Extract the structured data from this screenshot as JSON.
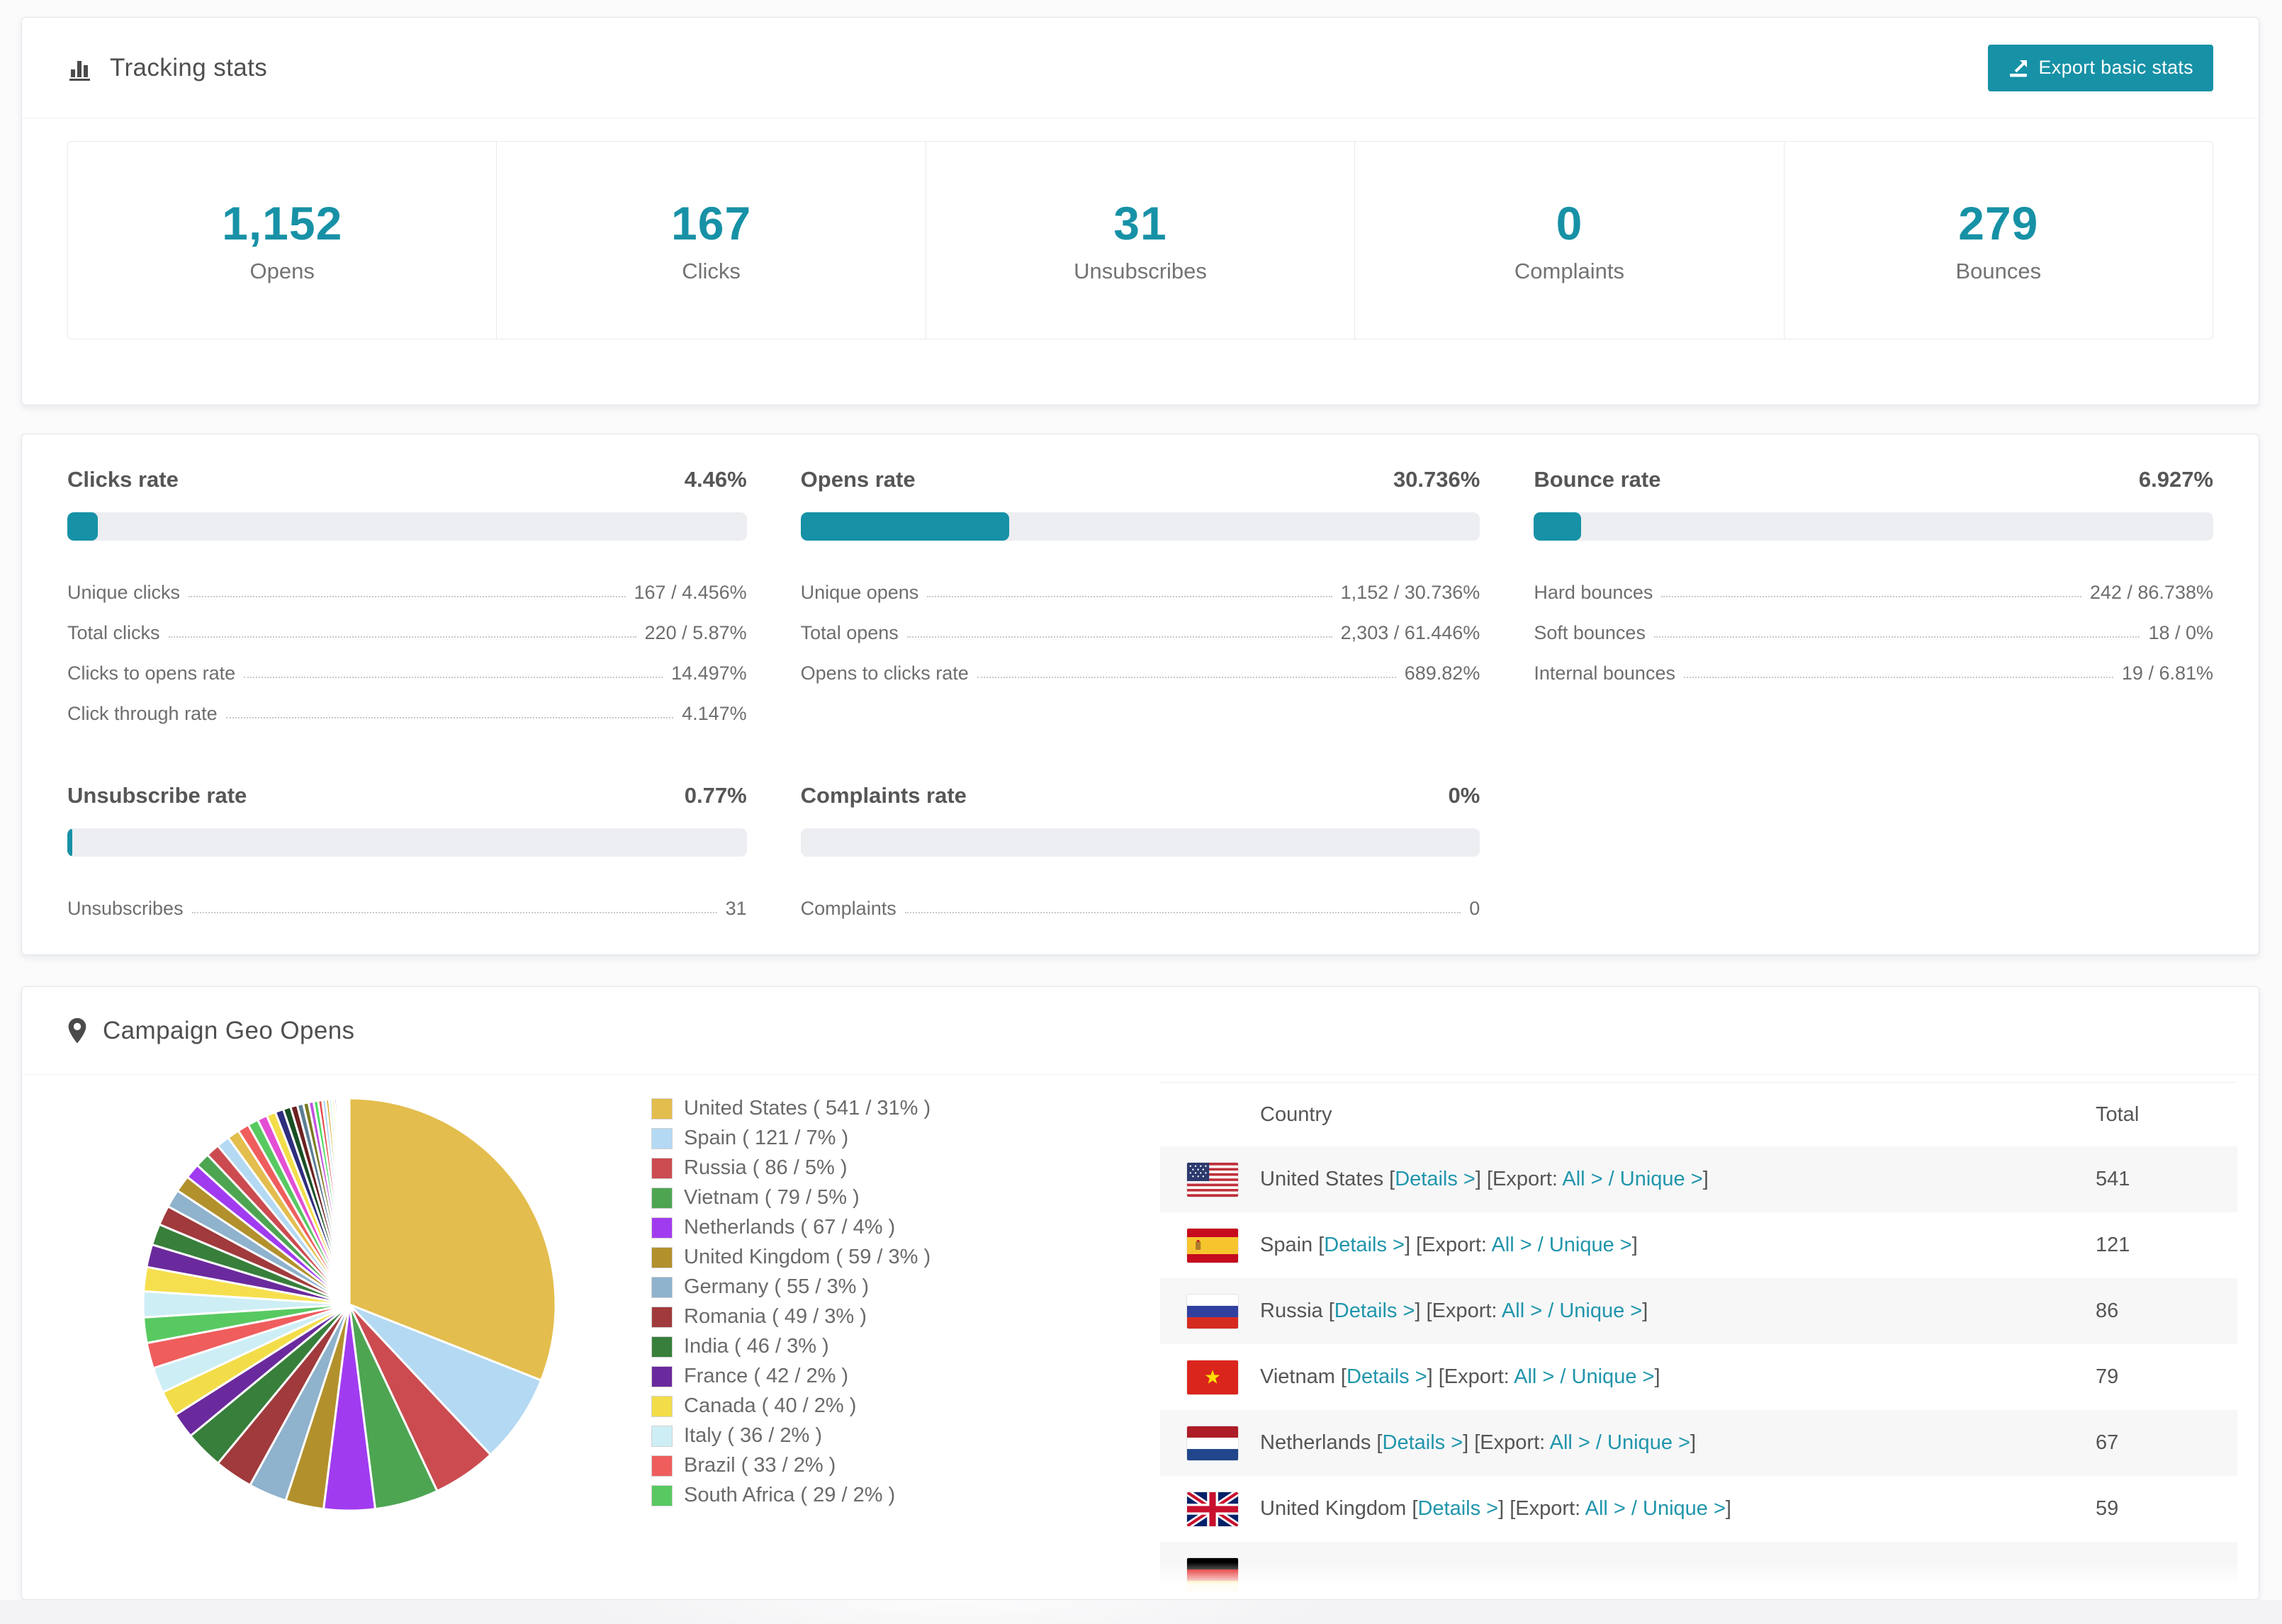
{
  "colors": {
    "accent": "#1791a6",
    "link": "#2095ab",
    "bar_track": "#eceef1",
    "row_stripe": "#f7f7f8"
  },
  "tracking": {
    "title": "Tracking stats",
    "export_button_label": "Export basic stats",
    "stats": [
      {
        "value": "1,152",
        "label": "Opens"
      },
      {
        "value": "167",
        "label": "Clicks"
      },
      {
        "value": "31",
        "label": "Unsubscribes"
      },
      {
        "value": "0",
        "label": "Complaints"
      },
      {
        "value": "279",
        "label": "Bounces"
      }
    ]
  },
  "rates": {
    "sections": [
      {
        "title": "Clicks rate",
        "value": "4.46%",
        "percent": 4.46,
        "rows": [
          {
            "label": "Unique clicks",
            "value": "167 / 4.456%"
          },
          {
            "label": "Total clicks",
            "value": "220 / 5.87%"
          },
          {
            "label": "Clicks to opens rate",
            "value": "14.497%"
          },
          {
            "label": "Click through rate",
            "value": "4.147%"
          }
        ]
      },
      {
        "title": "Opens rate",
        "value": "30.736%",
        "percent": 30.736,
        "rows": [
          {
            "label": "Unique opens",
            "value": "1,152 / 30.736%"
          },
          {
            "label": "Total opens",
            "value": "2,303 / 61.446%"
          },
          {
            "label": "Opens to clicks rate",
            "value": "689.82%"
          }
        ]
      },
      {
        "title": "Bounce rate",
        "value": "6.927%",
        "percent": 6.927,
        "rows": [
          {
            "label": "Hard bounces",
            "value": "242 / 86.738%"
          },
          {
            "label": "Soft bounces",
            "value": "18 / 0%"
          },
          {
            "label": "Internal bounces",
            "value": "19 / 6.81%"
          }
        ]
      },
      {
        "title": "Unsubscribe rate",
        "value": "0.77%",
        "percent": 0.77,
        "rows": [
          {
            "label": "Unsubscribes",
            "value": "31"
          }
        ]
      },
      {
        "title": "Complaints rate",
        "value": "0%",
        "percent": 0,
        "rows": [
          {
            "label": "Complaints",
            "value": "0"
          }
        ]
      }
    ]
  },
  "geo": {
    "title": "Campaign Geo Opens",
    "chart_data": {
      "type": "pie",
      "title": "Campaign Geo Opens",
      "legend_position": "right",
      "start_angle_deg": 0,
      "direction": "clockwise",
      "slices": [
        {
          "label": "United States",
          "count": 541,
          "percent": 31,
          "color": "#e3bd4d"
        },
        {
          "label": "Spain",
          "count": 121,
          "percent": 7,
          "color": "#b4d9f3"
        },
        {
          "label": "Russia",
          "count": 86,
          "percent": 5,
          "color": "#cb4b50"
        },
        {
          "label": "Vietnam",
          "count": 79,
          "percent": 5,
          "color": "#4da552"
        },
        {
          "label": "Netherlands",
          "count": 67,
          "percent": 4,
          "color": "#a13bf0"
        },
        {
          "label": "United Kingdom",
          "count": 59,
          "percent": 3,
          "color": "#b2912c"
        },
        {
          "label": "Germany",
          "count": 55,
          "percent": 3,
          "color": "#8fb2cd"
        },
        {
          "label": "Romania",
          "count": 49,
          "percent": 3,
          "color": "#a03a3c"
        },
        {
          "label": "India",
          "count": 46,
          "percent": 3,
          "color": "#377f3b"
        },
        {
          "label": "France",
          "count": 42,
          "percent": 2,
          "color": "#6a2a9d"
        },
        {
          "label": "Canada",
          "count": 40,
          "percent": 2,
          "color": "#f2dd49"
        },
        {
          "label": "Italy",
          "count": 36,
          "percent": 2,
          "color": "#cdeef5"
        },
        {
          "label": "Brazil",
          "count": 33,
          "percent": 2,
          "color": "#ef5d5d"
        },
        {
          "label": "South Africa",
          "count": 29,
          "percent": 2,
          "color": "#58c961"
        }
      ],
      "unlabeled_slices": {
        "note": "many small unlabeled countries fanning out toward 12 o'clock",
        "total_percent_approx": 26,
        "weights": [
          1.7,
          1.6,
          1.5,
          1.4,
          1.3,
          1.2,
          1.1,
          1.0,
          0.95,
          0.9,
          0.85,
          0.8,
          0.75,
          0.7,
          0.65,
          0.6,
          0.55,
          0.5,
          0.45,
          0.4,
          0.36,
          0.33,
          0.3,
          0.27,
          0.24,
          0.21,
          0.19,
          0.17,
          0.15,
          0.13,
          0.11,
          0.1,
          0.09,
          0.08,
          0.07,
          0.06,
          0.05,
          0.05,
          0.04,
          0.04
        ],
        "colors": [
          "#cdeef5",
          "#f6df4e",
          "#6a2a9d",
          "#377f3b",
          "#a03a3c",
          "#8fb2cd",
          "#b2912c",
          "#a13bf0",
          "#4da552",
          "#cb4b50",
          "#b4d9f3",
          "#e3bd4d",
          "#ef5d5d",
          "#58c961",
          "#e34fd4",
          "#f2dd49",
          "#2f2d7e",
          "#184f24",
          "#6e2020",
          "#5b7e95",
          "#7a7a22",
          "#c44fe0",
          "#4bdc5f",
          "#e04b4b",
          "#a9d3f5",
          "#d4a017",
          "#caf0f0",
          "#efe98f",
          "#34308f",
          "#8f3131",
          "#cc66e0",
          "#66e066",
          "#e06666",
          "#b3d9f2",
          "#e0c24c",
          "#7fe0d4",
          "#ff66cc",
          "#3a3a9f",
          "#9f3a3a",
          "#6fa0b8"
        ]
      }
    },
    "legend_format": "{label} ( {count} / {percent}% )",
    "table": {
      "headers": [
        "Country",
        "Total"
      ],
      "details_label": "Details",
      "export_label": "Export:",
      "all_label": "All",
      "unique_label": "Unique",
      "rows": [
        {
          "country": "United States",
          "flag": "us",
          "total": "541"
        },
        {
          "country": "Spain",
          "flag": "es",
          "total": "121"
        },
        {
          "country": "Russia",
          "flag": "ru",
          "total": "86"
        },
        {
          "country": "Vietnam",
          "flag": "vn",
          "total": "79"
        },
        {
          "country": "Netherlands",
          "flag": "nl",
          "total": "67"
        },
        {
          "country": "United Kingdom",
          "flag": "gb",
          "total": "59"
        }
      ],
      "partial_row": {
        "flag": "de"
      }
    }
  }
}
